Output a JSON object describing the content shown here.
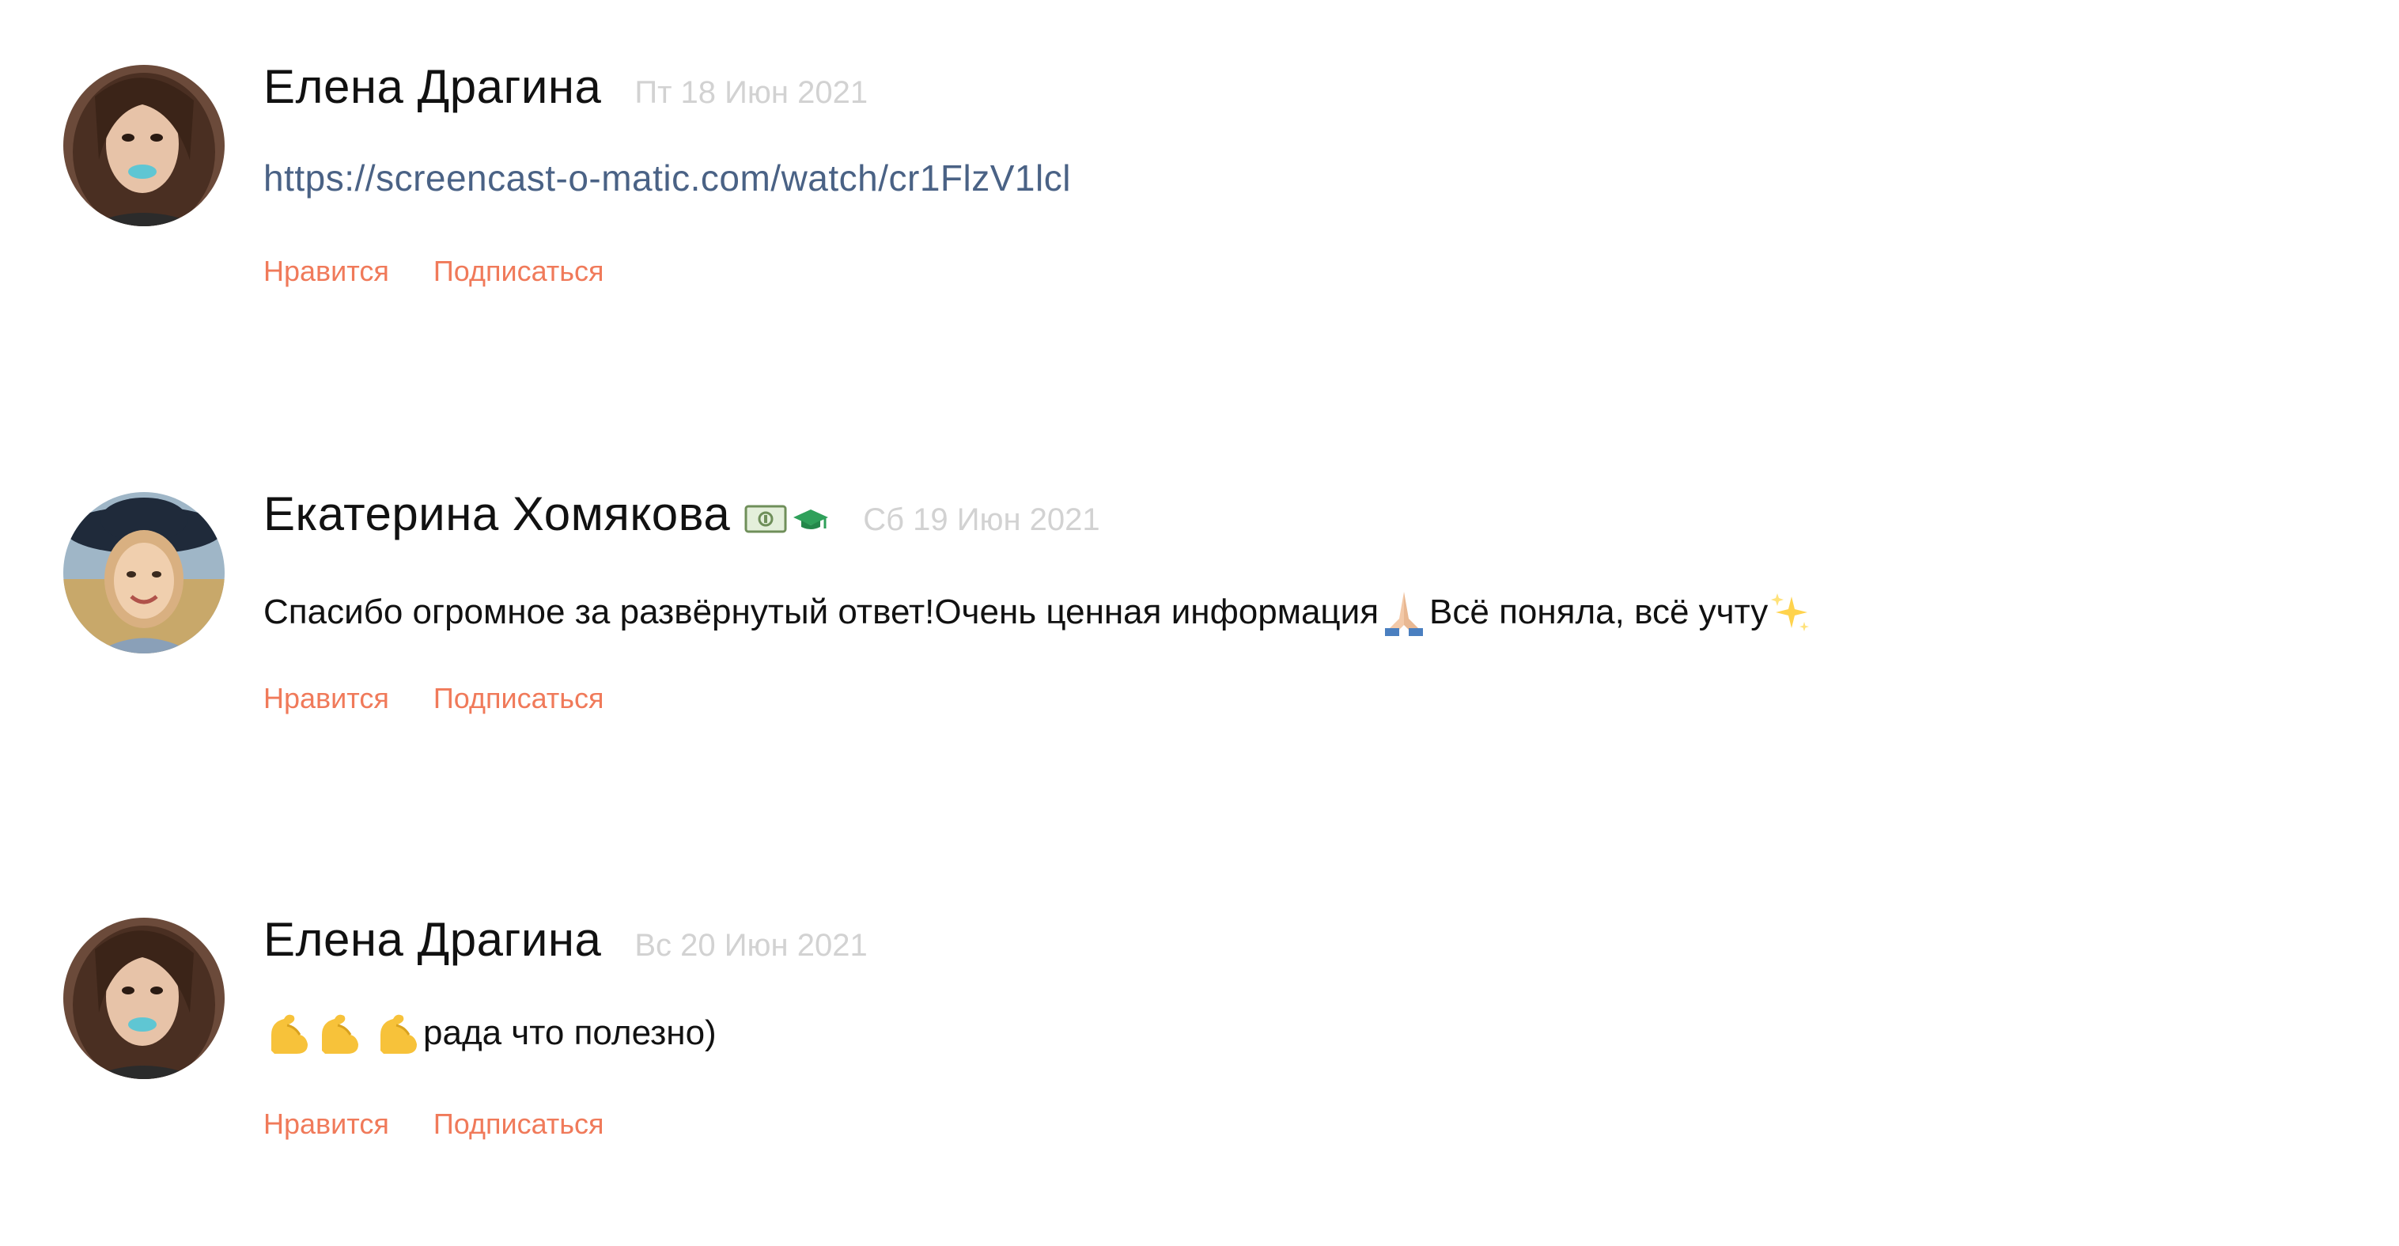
{
  "comments": [
    {
      "author": "Елена Драгина",
      "date": "Пт 18 Июн 2021",
      "text": "https://screencast-o-matic.com/watch/cr1FlzV1lcl",
      "like_label": "Нравится",
      "subscribe_label": "Подписаться"
    },
    {
      "author": "Екатерина Хомякова",
      "date": "Сб 19 Июн 2021",
      "text_part1": "Спасибо огромное за развёрнутый ответ!Очень ценная информация",
      "text_part2": "Всё поняла, всё учту ",
      "like_label": "Нравится",
      "subscribe_label": "Подписаться",
      "badge_icons": [
        "money-icon",
        "graduation-cap-icon"
      ]
    },
    {
      "author": "Елена Драгина",
      "date": "Вс 20 Июн 2021",
      "text": "рада что полезно)",
      "like_label": "Нравится",
      "subscribe_label": "Подписаться"
    }
  ],
  "colors": {
    "link": "#4a6285",
    "action": "#f07a5a",
    "date": "#d2d2d2",
    "text": "#111111"
  }
}
